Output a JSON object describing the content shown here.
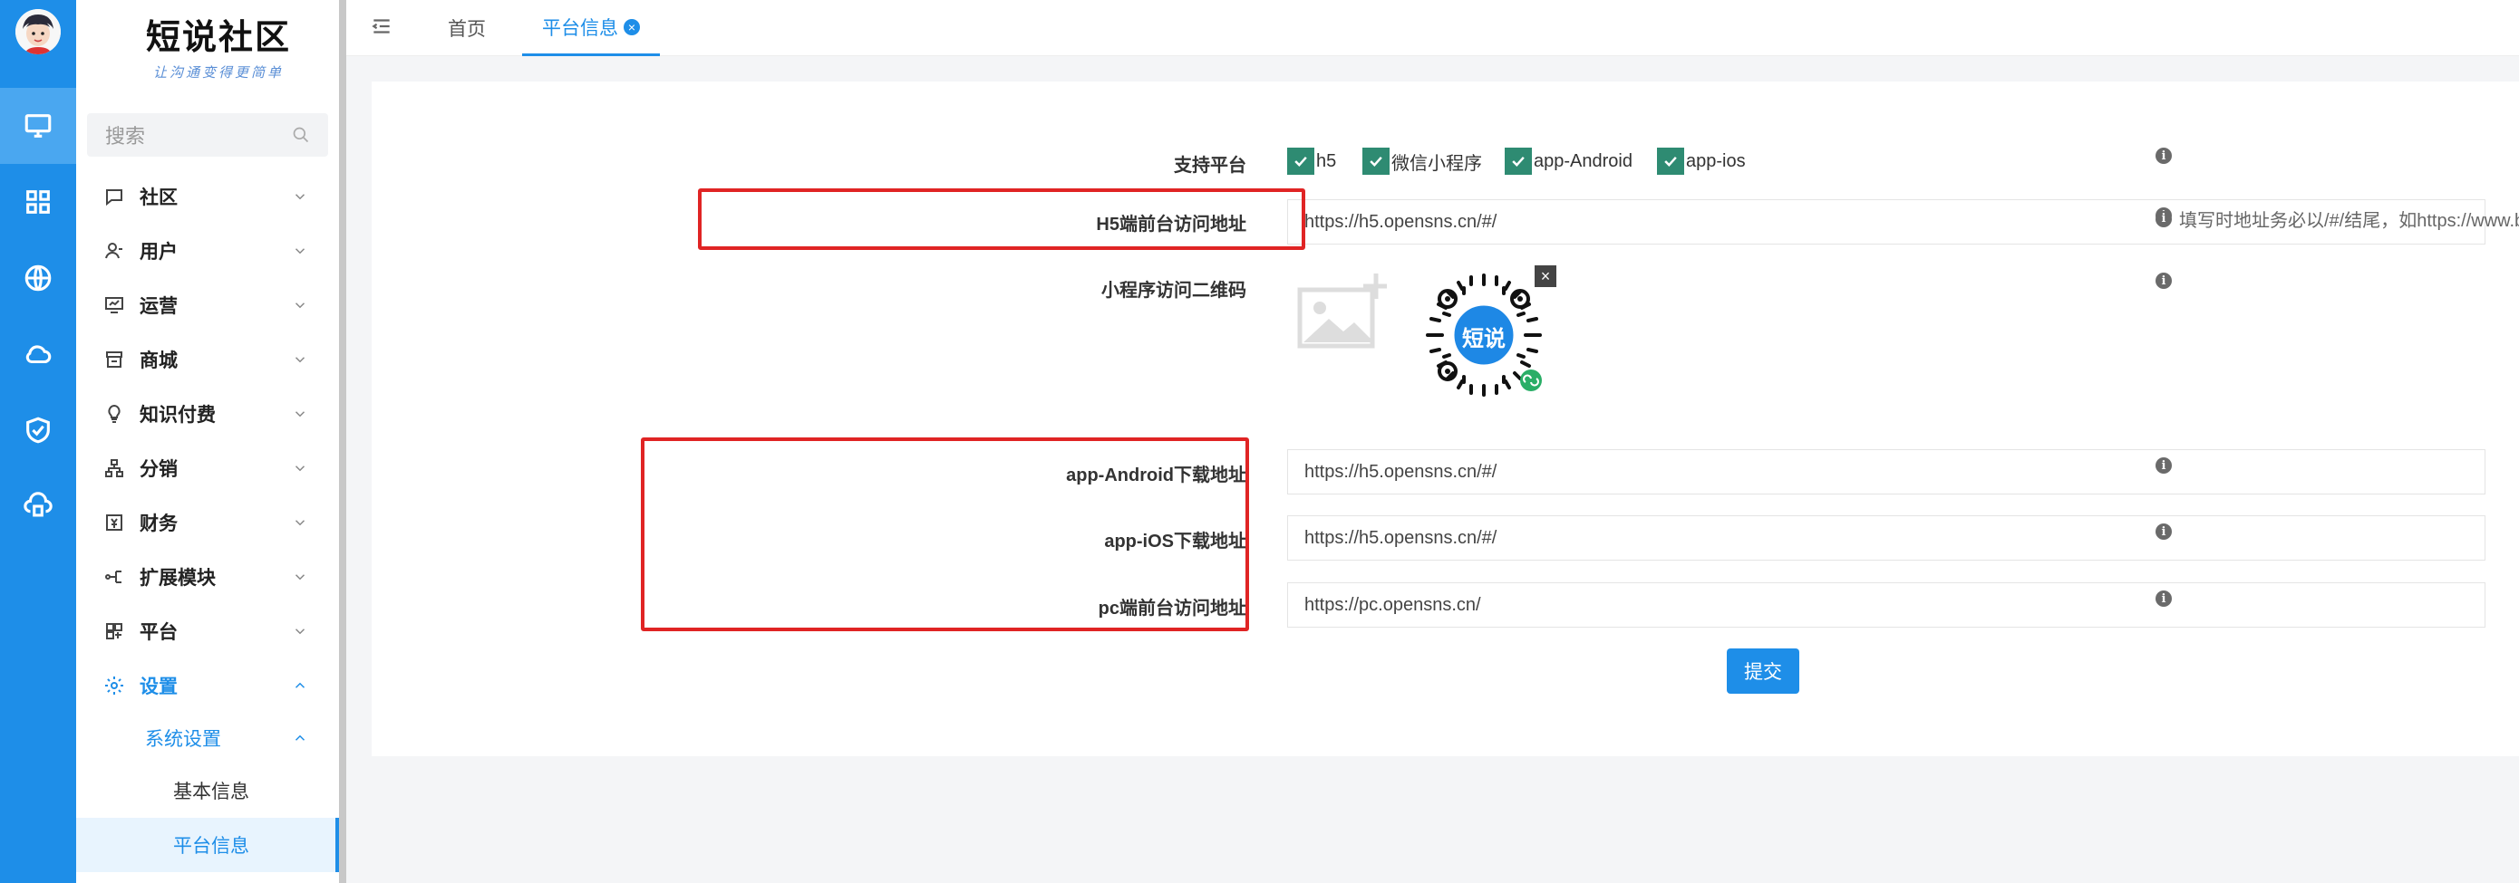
{
  "brand": {
    "title": "短说社区",
    "subtitle": "让沟通变得更简单"
  },
  "search": {
    "placeholder": "搜索"
  },
  "sidebar": {
    "items": [
      {
        "label": "社区",
        "icon": "chat-bubble-icon"
      },
      {
        "label": "用户",
        "icon": "user-icon"
      },
      {
        "label": "运营",
        "icon": "monitor-chart-icon"
      },
      {
        "label": "商城",
        "icon": "store-icon"
      },
      {
        "label": "知识付费",
        "icon": "lightbulb-icon"
      },
      {
        "label": "分销",
        "icon": "org-tree-icon"
      },
      {
        "label": "财务",
        "icon": "finance-icon"
      },
      {
        "label": "扩展模块",
        "icon": "extend-icon"
      },
      {
        "label": "平台",
        "icon": "platform-icon"
      },
      {
        "label": "设置",
        "icon": "gear-icon"
      }
    ],
    "sub_group": "系统设置",
    "sub_items": [
      "基本信息",
      "平台信息"
    ]
  },
  "tabs": {
    "home": "首页",
    "current": "平台信息"
  },
  "form": {
    "platform_label": "支持平台",
    "platforms": [
      "h5",
      "微信小程序",
      "app-Android",
      "app-ios"
    ],
    "h5_label": "H5端前台访问地址",
    "h5_value": "https://h5.opensns.cn/#/",
    "h5_hint": "填写时地址务必以/#/结尾，如https://www.ba",
    "qrcode_label": "小程序访问二维码",
    "qrcode_text": "短说",
    "android_label": "app-Android下载地址",
    "android_value": "https://h5.opensns.cn/#/",
    "ios_label": "app-iOS下载地址",
    "ios_value": "https://h5.opensns.cn/#/",
    "pc_label": "pc端前台访问地址",
    "pc_value": "https://pc.opensns.cn/",
    "submit": "提交"
  },
  "colors": {
    "primary": "#1e8ee8",
    "checkbox": "#2e8b72",
    "highlight": "#e02424"
  }
}
